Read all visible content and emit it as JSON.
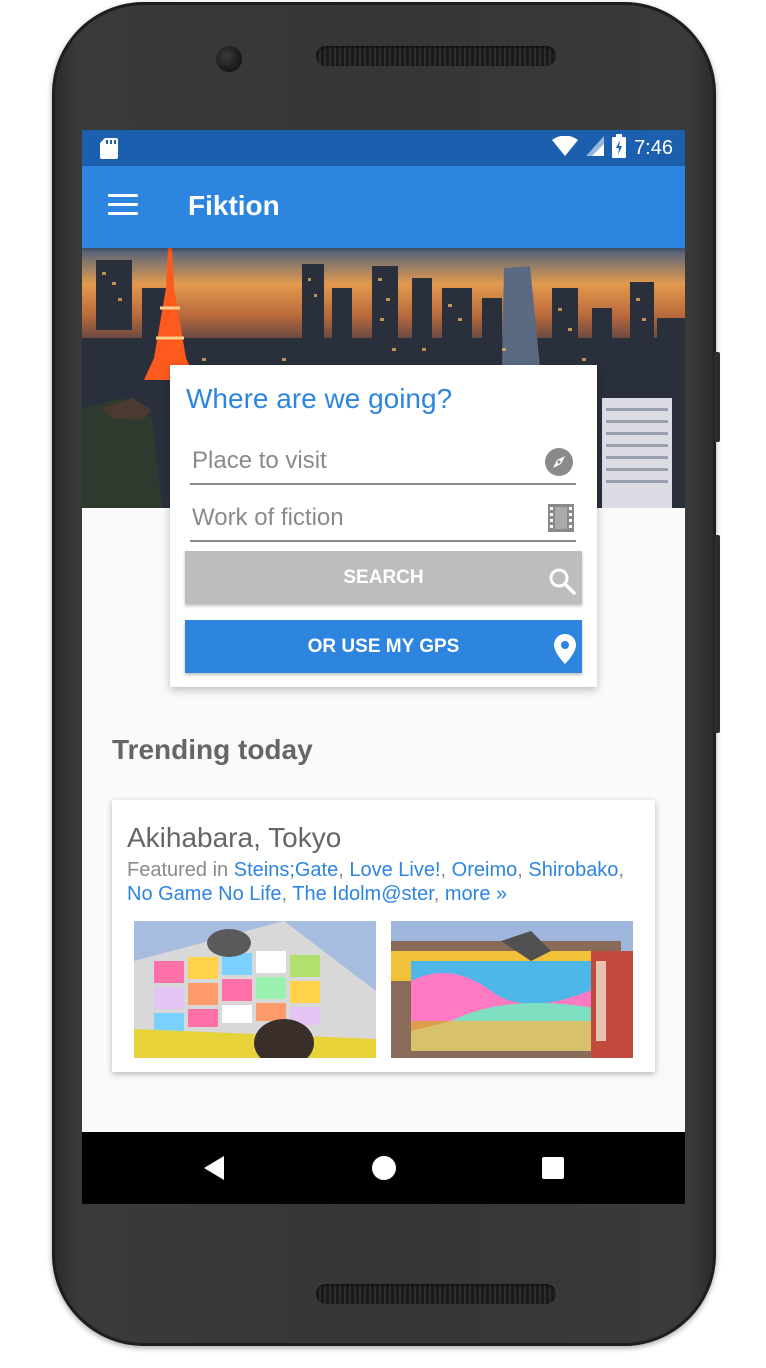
{
  "status_bar": {
    "time": "7:46",
    "icons": [
      "sd-card-icon",
      "wifi-icon",
      "signal-icon",
      "battery-charging-icon"
    ]
  },
  "app_bar": {
    "title": "Fiktion",
    "menu_icon": "hamburger-menu-icon"
  },
  "search_card": {
    "heading": "Where are we going?",
    "place_placeholder": "Place to visit",
    "place_icon": "compass-icon",
    "fiction_placeholder": "Work of fiction",
    "fiction_icon": "film-strip-icon",
    "search_button": "SEARCH",
    "search_icon": "search-icon",
    "gps_button": "OR USE MY GPS",
    "gps_icon": "location-pin-icon"
  },
  "trending": {
    "title": "Trending today",
    "place": {
      "name": "Akihabara, Tokyo",
      "featured_prefix": "Featured in ",
      "works": [
        "Steins;Gate",
        "Love Live!",
        "Oreimo",
        "Shirobako",
        "No Game No Life",
        "The Idolm@ster"
      ],
      "more": "more »"
    }
  },
  "nav_bar": {
    "icons": [
      "back-icon",
      "home-icon",
      "recents-icon"
    ]
  },
  "colors": {
    "primary": "#2d85e0",
    "primary_dark": "#1c5fae",
    "disabled_button": "#bdbdbd",
    "text_grey": "#666666"
  }
}
